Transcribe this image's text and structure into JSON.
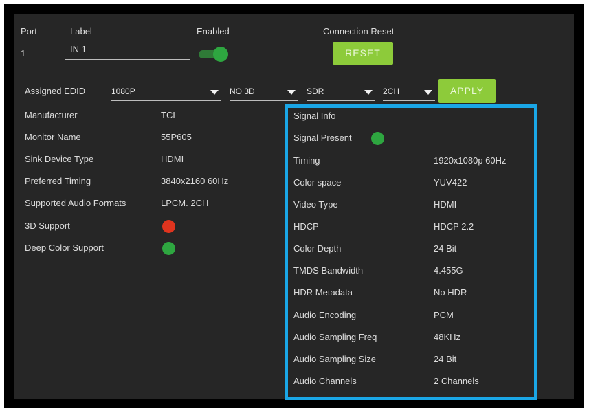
{
  "header": {
    "port_label": "Port",
    "port_value": "1",
    "label_label": "Label",
    "label_value": "IN 1",
    "enabled_label": "Enabled",
    "connection_reset_label": "Connection Reset",
    "reset_button": "RESET"
  },
  "edid": {
    "label": "Assigned EDID",
    "resolution": "1080P",
    "threed": "NO 3D",
    "hdr": "SDR",
    "audio": "2CH",
    "apply_button": "APPLY"
  },
  "sink": {
    "rows": [
      {
        "label": "Manufacturer",
        "value": "TCL"
      },
      {
        "label": "Monitor Name",
        "value": "55P605"
      },
      {
        "label": "Sink Device Type",
        "value": "HDMI"
      },
      {
        "label": "Preferred Timing",
        "value": "3840x2160 60Hz"
      },
      {
        "label": "Supported Audio Formats",
        "value": "LPCM. 2CH"
      }
    ],
    "support_3d_label": "3D Support",
    "deep_color_label": "Deep Color Support"
  },
  "signal": {
    "title": "Signal Info",
    "signal_present_label": "Signal Present",
    "rows": [
      {
        "label": "Timing",
        "value": "1920x1080p 60Hz"
      },
      {
        "label": "Color space",
        "value": "YUV422"
      },
      {
        "label": "Video Type",
        "value": "HDMI"
      },
      {
        "label": "HDCP",
        "value": "HDCP 2.2"
      },
      {
        "label": "Color Depth",
        "value": "24 Bit"
      },
      {
        "label": "TMDS Bandwidth",
        "value": "4.455G"
      },
      {
        "label": "HDR Metadata",
        "value": "No HDR"
      },
      {
        "label": "Audio Encoding",
        "value": "PCM"
      },
      {
        "label": "Audio Sampling Freq",
        "value": "48KHz"
      },
      {
        "label": "Audio Sampling Size",
        "value": "24 Bit"
      },
      {
        "label": "Audio Channels",
        "value": "2 Channels"
      }
    ]
  },
  "colors": {
    "green_status": "#2ea640",
    "red_status": "#e0341e",
    "accent_button": "#8dcb3a",
    "highlight_border": "#1aa6e6"
  }
}
